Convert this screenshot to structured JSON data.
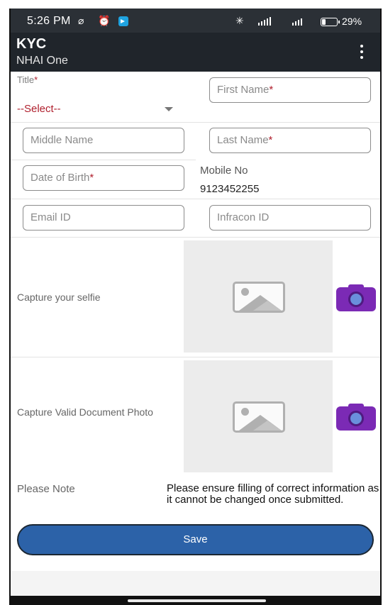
{
  "status_bar": {
    "time": "5:26 PM",
    "battery_pct": "29%",
    "icons": [
      "no-wifi-icon",
      "alarm-icon",
      "telegram-icon",
      "bluetooth-icon",
      "signal-icon",
      "battery-icon"
    ]
  },
  "app_bar": {
    "title": "KYC",
    "subtitle": "NHAI One",
    "menu_icon": "more-vertical-icon"
  },
  "form": {
    "title_label": "Title",
    "title_value": "--Select--",
    "first_name_placeholder": "First Name",
    "middle_name_placeholder": "Middle Name",
    "last_name_placeholder": "Last Name",
    "dob_placeholder": "Date of Birth",
    "required_mark": "*",
    "mobile_label": "Mobile No",
    "mobile_value": "9123452255",
    "email_placeholder": "Email ID",
    "infracon_placeholder": "Infracon ID",
    "selfie_label": "Capture your selfie",
    "document_label": "Capture Valid Document Photo",
    "note_label": "Please Note",
    "note_text": "Please ensure filling of correct information as it cannot be changed once submitted.",
    "save_label": "Save"
  },
  "colors": {
    "app_bar": "#20252b",
    "status_bar": "#2b3036",
    "required": "#b0202e",
    "save_button": "#2c62a8",
    "camera_icon": "#7b2ab5",
    "placeholder_box": "#ececec"
  }
}
